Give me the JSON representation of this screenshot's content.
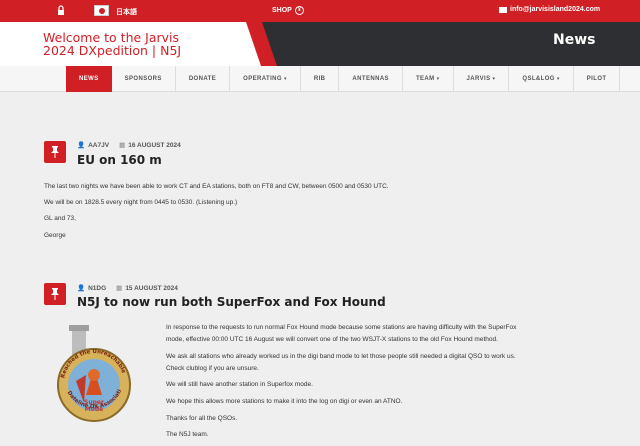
{
  "topbar": {
    "lang_label": "日本語",
    "shop_label": "SHOP",
    "email": "info@jarvisisland2024.com"
  },
  "header": {
    "site_title_line1": "Welcome to the Jarvis",
    "site_title_line2": "2024 DXpedition | N5J",
    "page_heading": "News"
  },
  "nav": {
    "items": [
      {
        "label": "NEWS",
        "active": true,
        "caret": false
      },
      {
        "label": "SPONSORS",
        "active": false,
        "caret": false
      },
      {
        "label": "DONATE",
        "active": false,
        "caret": false
      },
      {
        "label": "OPERATING",
        "active": false,
        "caret": true
      },
      {
        "label": "RIB",
        "active": false,
        "caret": false
      },
      {
        "label": "ANTENNAS",
        "active": false,
        "caret": false
      },
      {
        "label": "TEAM",
        "active": false,
        "caret": true
      },
      {
        "label": "JARVIS",
        "active": false,
        "caret": true
      },
      {
        "label": "QSL&LOG",
        "active": false,
        "caret": true
      },
      {
        "label": "PILOT",
        "active": false,
        "caret": false
      }
    ]
  },
  "posts": [
    {
      "author": "AA7JV",
      "date": "16 AUGUST 2024",
      "title": "EU on 160 m",
      "paragraphs": [
        "The last two nights we have been able to work CT and EA stations, both on FT8 and CW, between 0500 and 0530 UTC.",
        "We will be on 1828.5 every night from 0445 to 0530. (Listening up.)",
        "GL and 73,",
        "George"
      ]
    },
    {
      "author": "N1DG",
      "date": "15 AUGUST 2024",
      "title": "N5J to now run both SuperFox and Fox Hound",
      "paragraphs": [
        "In response to the requests to run normal Fox Hound mode because some stations are having difficulty with the SuperFox",
        "mode, effective 00:00 UTC 16 August we will convert one of the two WSJT-X stations to the old Fox Hound method.",
        "We ask all stations who already worked us in the digi band mode to let those people still needed a digital QSO to work us.",
        "Check clublog if you are unsure.",
        "We will still have another station in Superfox mode.",
        "We hope this allows more stations to make it into the log on digi or even an ATNO.",
        "Thanks for all the QSOs.",
        "The N5J team."
      ],
      "logo": {
        "ring_text_top": "Reached the Unreachable",
        "ring_text_bottom": "Dateline DX Association",
        "center_text_1": "Super",
        "center_text_2": "Mode"
      }
    }
  ]
}
